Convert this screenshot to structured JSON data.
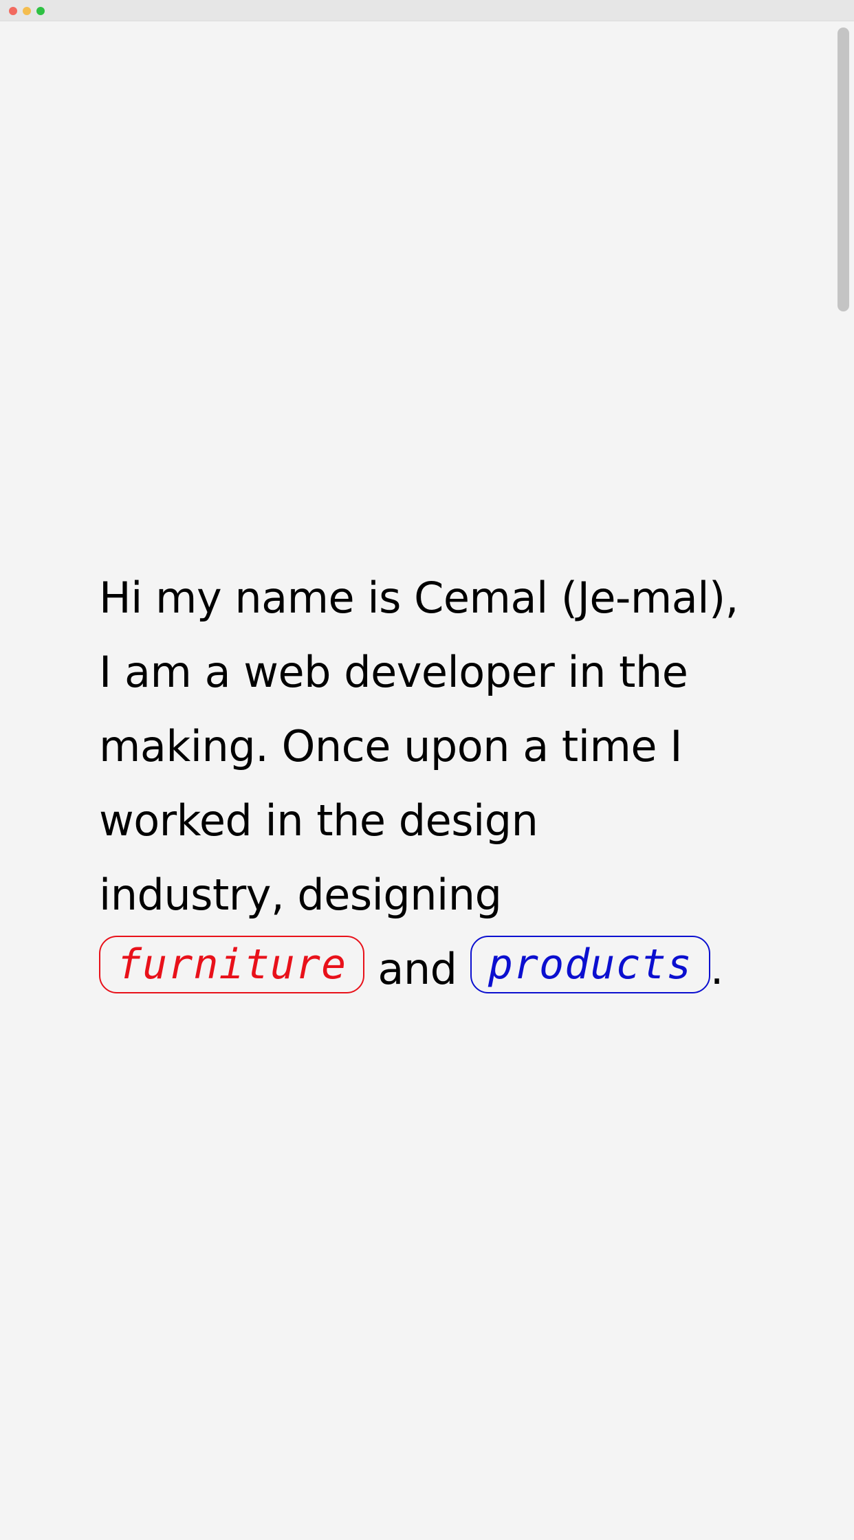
{
  "intro": {
    "line1": "Hi my name is Cemal (Je-mal),",
    "line2": "I am a web developer in the",
    "line3": "making. Once upon a time I",
    "line4": "worked in the design",
    "line5": "industry, designing",
    "link1": "furniture",
    "between": "and",
    "link2": "products",
    "end": "."
  },
  "colors": {
    "background": "#f4f4f4",
    "text": "#000000",
    "furniture_link": "#e8111a",
    "products_link": "#0b0fcf"
  },
  "icons": {
    "window_close": "traffic-light-red",
    "window_minimize": "traffic-light-yellow",
    "window_maximize": "traffic-light-green"
  }
}
